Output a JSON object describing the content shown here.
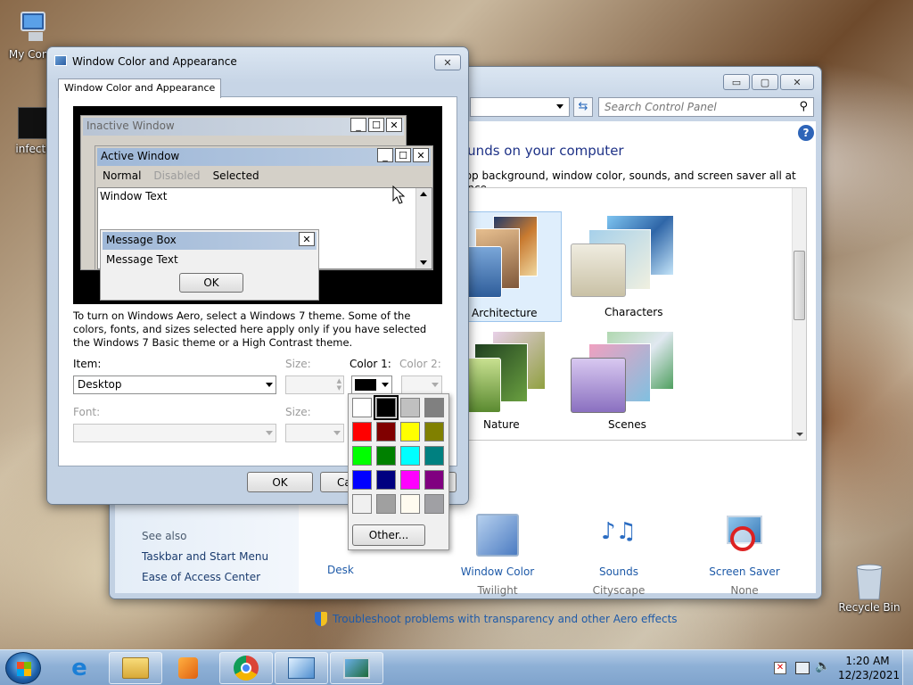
{
  "desktop": {
    "icons": [
      {
        "label": "My Comp"
      },
      {
        "label": "infecte"
      },
      {
        "label": "Recycle Bin"
      }
    ]
  },
  "control_panel": {
    "search_placeholder": "Search Control Panel",
    "heading": "ounds on your computer",
    "description": "top background, window color, sounds, and screen saver all at once.",
    "themes": [
      {
        "name": "Architecture",
        "selected": true
      },
      {
        "name": "Characters"
      },
      {
        "name": "Nature"
      },
      {
        "name": "Scenes"
      }
    ],
    "bottom_items": [
      {
        "title": "Desk",
        "sub": ""
      },
      {
        "title": "Window Color",
        "sub": "Twilight"
      },
      {
        "title": "Sounds",
        "sub": "Cityscape"
      },
      {
        "title": "Screen Saver",
        "sub": "None"
      }
    ],
    "see_also": {
      "heading": "See also",
      "links": [
        "Taskbar and Start Menu",
        "Ease of Access Center"
      ]
    },
    "troubleshoot_link": "Troubleshoot problems with transparency and other Aero effects"
  },
  "dialog": {
    "title": "Window Color and Appearance",
    "tab": "Window Color and Appearance",
    "preview": {
      "inactive_title": "Inactive Window",
      "active_title": "Active Window",
      "menu": [
        "Normal",
        "Disabled",
        "Selected"
      ],
      "window_text": "Window Text",
      "msgbox_title": "Message Box",
      "msgbox_text": "Message Text",
      "msgbox_ok": "OK"
    },
    "info_text": "To turn on Windows Aero, select a Windows 7 theme.  Some of the colors, fonts, and sizes selected here apply only if you have selected the Windows 7 Basic theme or a High Contrast theme.",
    "item_label": "Item:",
    "item_value": "Desktop",
    "size_label": "Size:",
    "color1_label": "Color 1:",
    "color2_label": "Color 2:",
    "font_label": "Font:",
    "size2_label": "Size:",
    "ok_label": "OK",
    "cancel_label": "Ca"
  },
  "palette": {
    "colors": [
      "#ffffff",
      "#000000",
      "#c0c0c0",
      "#808080",
      "#ff0000",
      "#800000",
      "#ffff00",
      "#808000",
      "#00ff00",
      "#008000",
      "#00ffff",
      "#008080",
      "#0000ff",
      "#000080",
      "#ff00ff",
      "#800080",
      "#f0f0f0",
      "#a0a0a0",
      "#fffbf0",
      "#a0a0a4"
    ],
    "selected_index": 1,
    "other_label": "Other..."
  },
  "taskbar": {
    "time": "1:20 AM",
    "date": "12/23/2021"
  }
}
